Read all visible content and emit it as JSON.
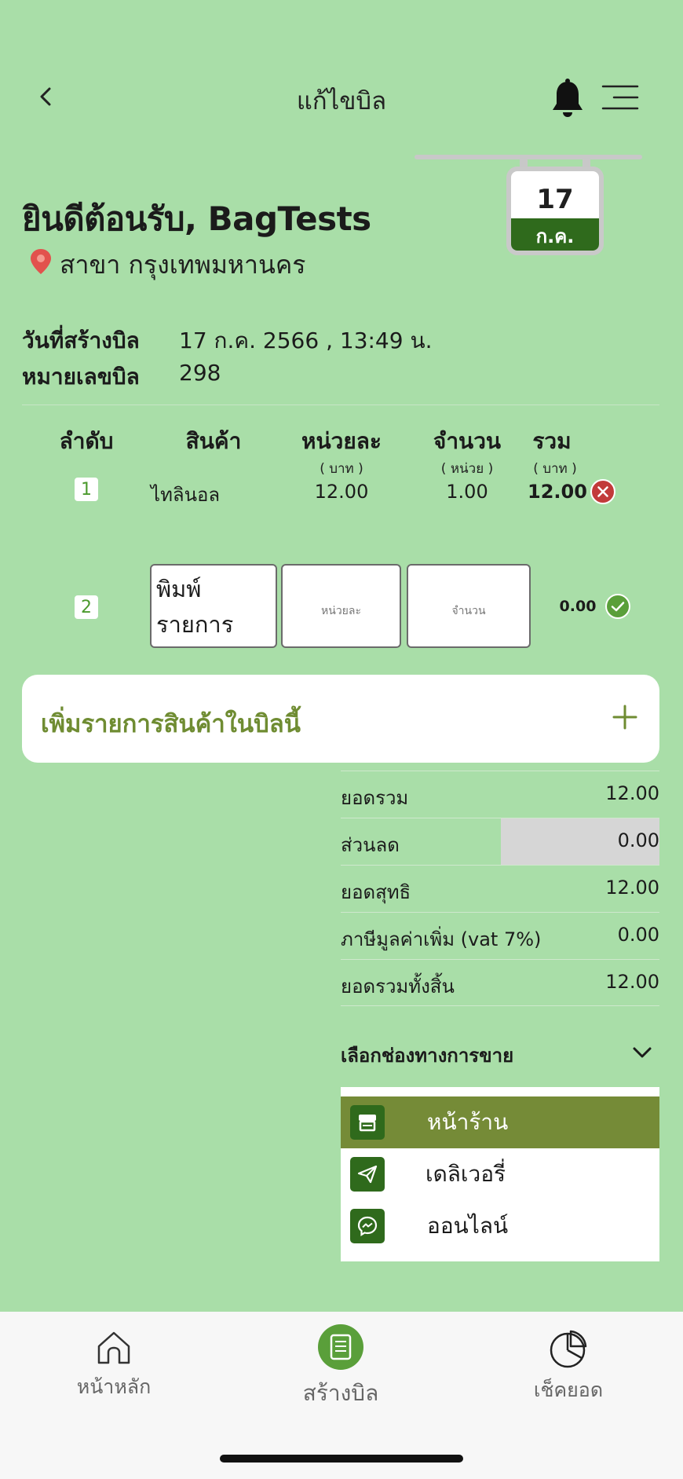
{
  "header": {
    "title": "แก้ไขบิล",
    "back_icon": "chevron-left-icon",
    "bell_icon": "bell-icon",
    "menu_icon": "menu-icon"
  },
  "calendar": {
    "day": "17",
    "month": "ก.ค."
  },
  "welcome": "ยินดีต้อนรับ, BagTests",
  "branch": "สาขา กรุงเทพมหานคร",
  "bill_info": {
    "created_label": "วันที่สร้างบิล",
    "created_value": "17 ก.ค. 2566 , 13:49 น.",
    "number_label": "หมายเลขบิล",
    "number_value": "298"
  },
  "table": {
    "headers": [
      "ลำดับ",
      "สินค้า",
      "หน่วยละ",
      "จำนวน",
      "รวม"
    ],
    "subheaders": [
      "",
      "",
      "( บาท )",
      "( หน่วย )",
      "( บาท )"
    ],
    "rows": [
      {
        "no": "1",
        "product": "ไทลินอล",
        "unit_price": "12.00",
        "qty": "1.00",
        "total": "12.00"
      }
    ],
    "new_row": {
      "no": "2",
      "product_placeholder": "พิมพ์\nรายการ",
      "unit_placeholder": "หน่วยละ",
      "qty_placeholder": "จำนวน",
      "total": "0.00"
    }
  },
  "add_item_label": "เพิ่มรายการสินค้าในบิลนี้",
  "summary": [
    {
      "label": "ยอดรวม",
      "value": "12.00"
    },
    {
      "label": "ส่วนลด",
      "value": "0.00"
    },
    {
      "label": "ยอดสุทธิ",
      "value": "12.00"
    },
    {
      "label": "ภาษีมูลค่าเพิ่ม (vat 7%)",
      "value": "0.00"
    },
    {
      "label": "ยอดรวมทั้งสิ้น",
      "value": "12.00"
    }
  ],
  "channel": {
    "label": "เลือกช่องทางการขาย",
    "options": [
      {
        "label": "หน้าร้าน",
        "icon": "store-icon",
        "selected": true
      },
      {
        "label": "เดลิเวอรี่",
        "icon": "send-icon",
        "selected": false
      },
      {
        "label": "ออนไลน์",
        "icon": "messenger-icon",
        "selected": false
      }
    ]
  },
  "bottom_nav": [
    {
      "label": "หน้าหลัก",
      "icon": "home-icon"
    },
    {
      "label": "สร้างบิล",
      "icon": "bill-icon"
    },
    {
      "label": "เช็คยอด",
      "icon": "pie-chart-icon"
    }
  ],
  "colors": {
    "background": "#a9dea8",
    "accent_dark": "#2f6a1c",
    "accent_olive": "#758b37",
    "remove_red": "#c23a3a",
    "confirm_green": "#5a9f3a"
  }
}
